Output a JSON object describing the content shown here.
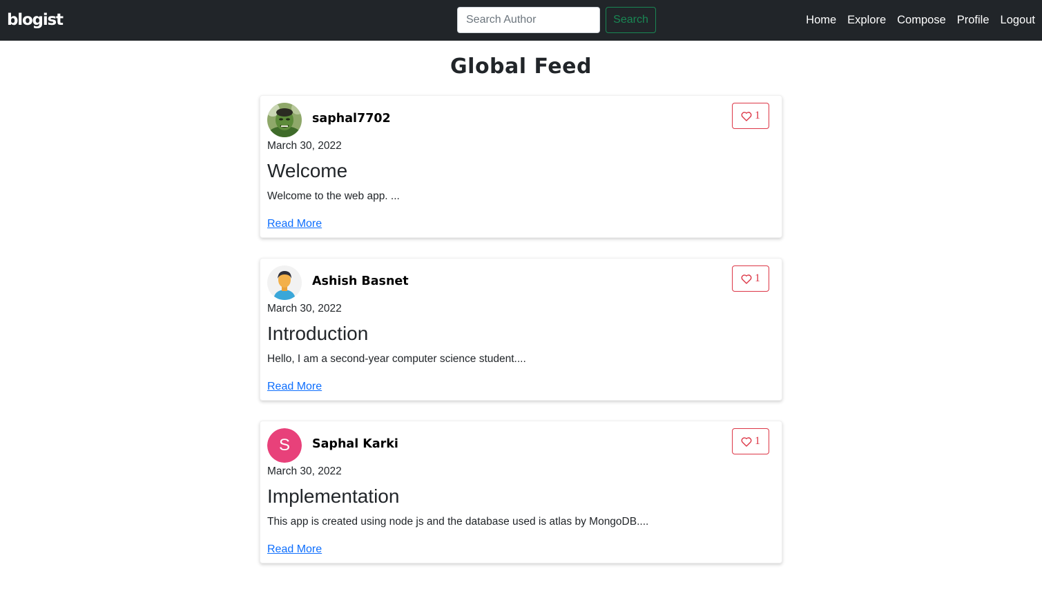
{
  "navbar": {
    "brand": "blogist",
    "search": {
      "placeholder": "Search Author",
      "value": "",
      "button_label": "Search"
    },
    "links": [
      "Home",
      "Explore",
      "Compose",
      "Profile",
      "Logout"
    ]
  },
  "main": {
    "title": "Global Feed",
    "posts": [
      {
        "author": "saphal7702",
        "avatar": "hulk-photo-avatar",
        "date": "March 30, 2022",
        "title": "Welcome",
        "excerpt": "Welcome to the web app. ...",
        "likes": "1",
        "read_more": "Read More"
      },
      {
        "author": "Ashish Basnet",
        "avatar": "person-illustration-avatar",
        "date": "March 30, 2022",
        "title": "Introduction",
        "excerpt": "Hello, I am a second-year computer science student....",
        "likes": "1",
        "read_more": "Read More"
      },
      {
        "author": "Saphal Karki",
        "avatar": "letter-avatar",
        "avatar_letter": "S",
        "avatar_color": "#e8417a",
        "date": "March 30, 2022",
        "title": "Implementation",
        "excerpt": "This app is created using node js and the database used is atlas by MongoDB....",
        "likes": "1",
        "read_more": "Read More"
      }
    ]
  },
  "colors": {
    "navbar_bg": "#212529",
    "search_accent": "#198754",
    "like_accent": "#dc3545",
    "link": "#0d6efd"
  },
  "icons": {
    "like": "heart-outline-icon"
  }
}
